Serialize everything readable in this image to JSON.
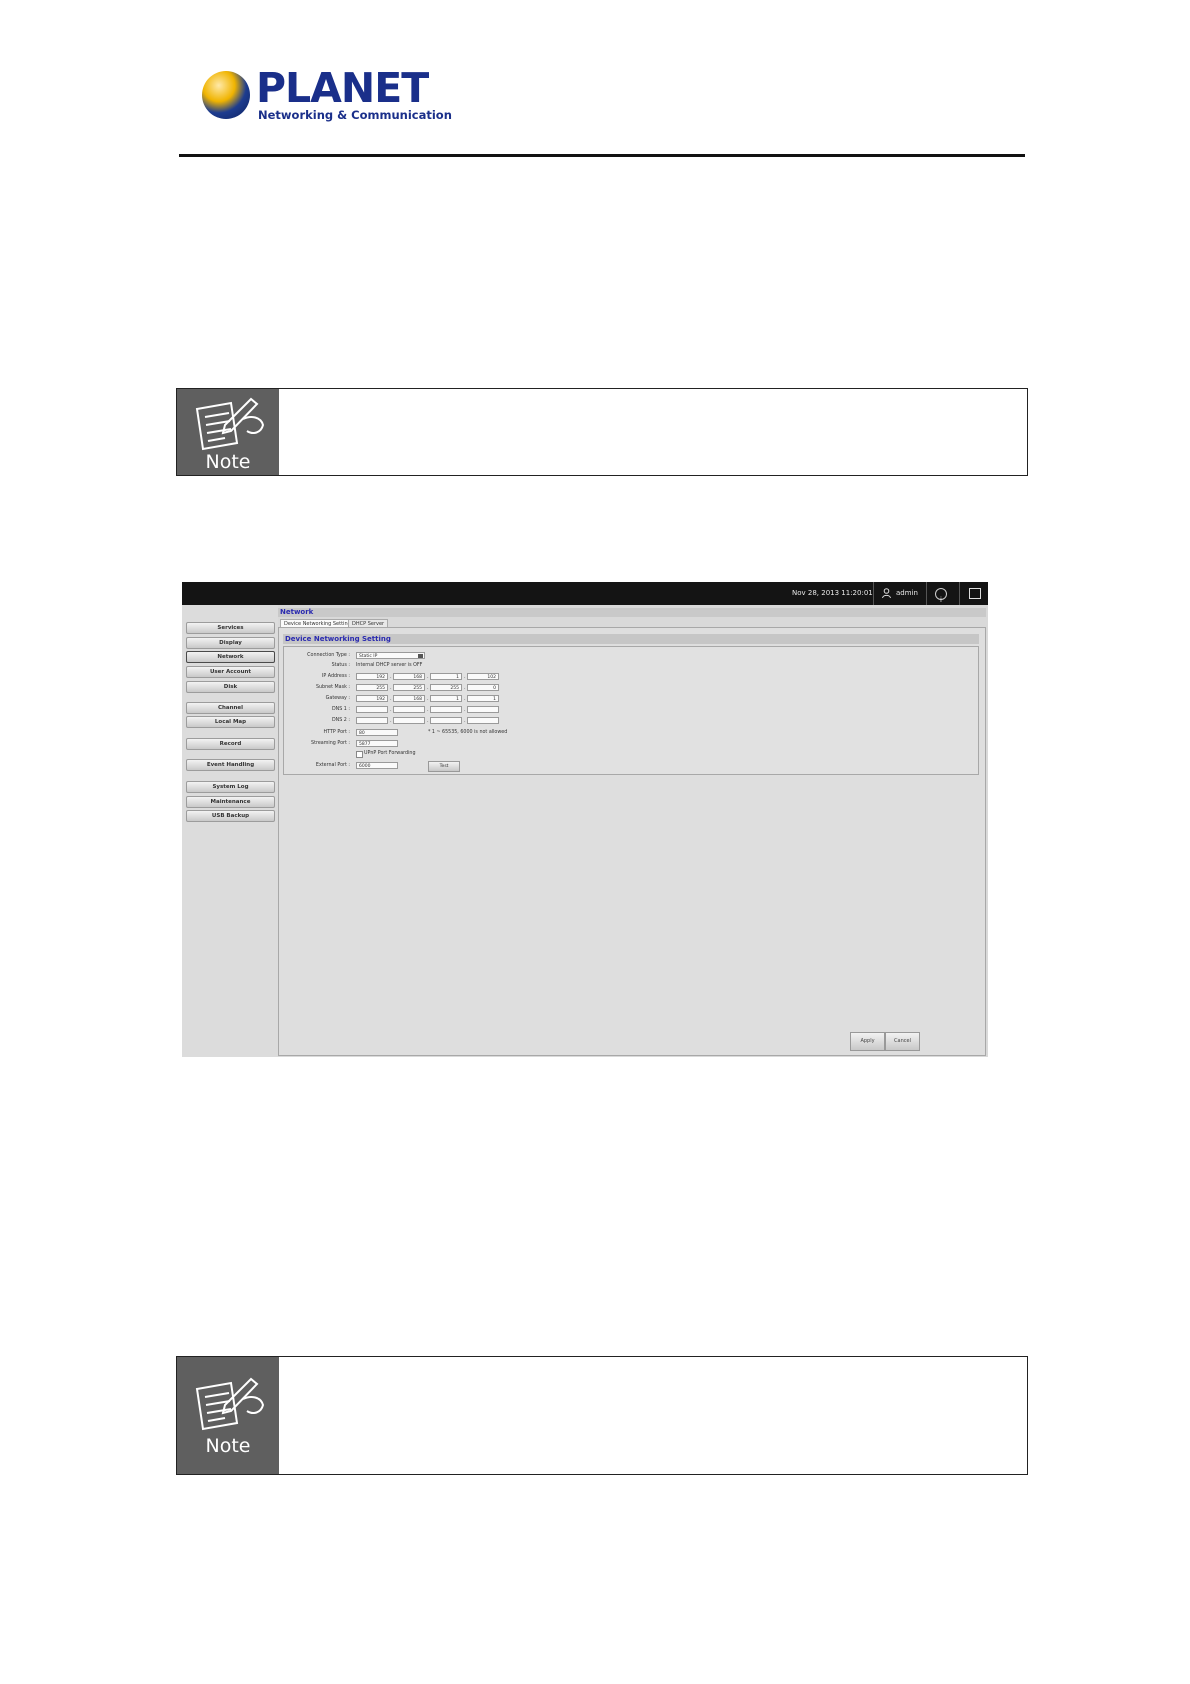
{
  "header": {
    "brand_name": "PLANET",
    "brand_tagline": "Networking & Communication"
  },
  "notes": [
    {
      "label": "Note"
    },
    {
      "label": "Note"
    }
  ],
  "screenshot": {
    "topbar": {
      "datetime": "Nov 28, 2013 11:20:01",
      "user": "admin",
      "icons": [
        "user-icon",
        "info-icon",
        "exit-icon"
      ]
    },
    "sidebar_items": [
      {
        "label": "Services",
        "active": false
      },
      {
        "label": "Display",
        "active": false
      },
      {
        "label": "Network",
        "active": true
      },
      {
        "label": "User Account",
        "active": false
      },
      {
        "label": "Disk",
        "active": false
      },
      {
        "label": "Channel",
        "active": false
      },
      {
        "label": "Local Map",
        "active": false
      },
      {
        "label": "Record",
        "active": false
      },
      {
        "label": "Event Handling",
        "active": false
      },
      {
        "label": "System Log",
        "active": false
      },
      {
        "label": "Maintenance",
        "active": false
      },
      {
        "label": "USB Backup",
        "active": false
      }
    ],
    "page_title": "Network",
    "tabs": [
      {
        "label": "Device Networking Setting",
        "active": true
      },
      {
        "label": "DHCP Server",
        "active": false
      }
    ],
    "section_title": "Device Networking Setting",
    "form": {
      "connection_type": {
        "label": "Connection Type :",
        "value": "Static IP"
      },
      "status": {
        "label": "Status :",
        "value": "Internal DHCP server is OFF"
      },
      "ip_address": {
        "label": "IP Address :",
        "octets": [
          "192",
          "168",
          "1",
          "102"
        ]
      },
      "subnet_mask": {
        "label": "Subnet Mask :",
        "octets": [
          "255",
          "255",
          "255",
          "0"
        ]
      },
      "gateway": {
        "label": "Gateway :",
        "octets": [
          "192",
          "168",
          "1",
          "1"
        ]
      },
      "dns1": {
        "label": "DNS 1 :",
        "octets": [
          "",
          "",
          "",
          ""
        ]
      },
      "dns2": {
        "label": "DNS 2 :",
        "octets": [
          "",
          "",
          "",
          ""
        ]
      },
      "http_port": {
        "label": "HTTP Port :",
        "value": "80",
        "hint": "* 1 ~ 65535, 6000 is not allowed"
      },
      "streaming_port": {
        "label": "Streaming Port :",
        "value": "5877"
      },
      "upnp": {
        "label": "UPnP Port Forwarding",
        "checked": false
      },
      "external_port": {
        "label": "External Port :",
        "value": "6000",
        "test_label": "Test"
      }
    },
    "buttons": {
      "apply": "Apply",
      "cancel": "Cancel"
    }
  }
}
